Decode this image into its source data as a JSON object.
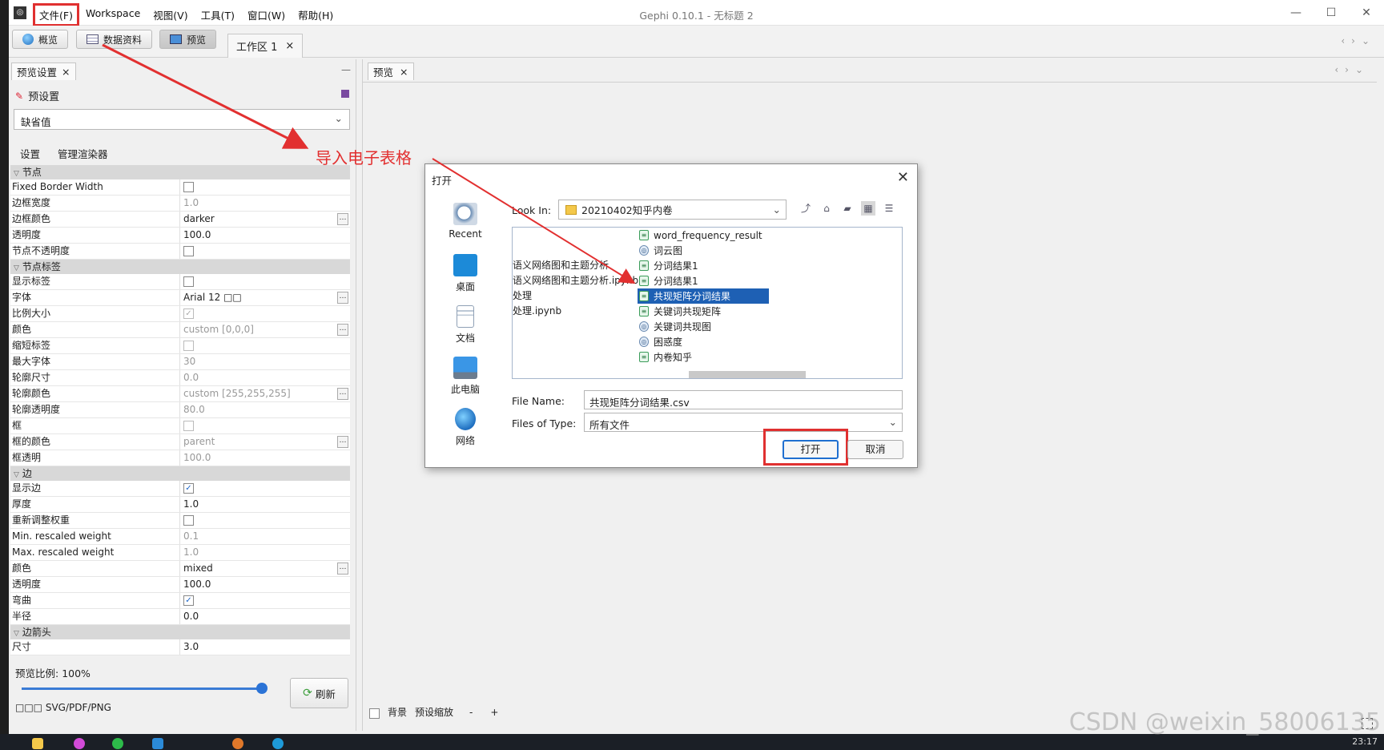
{
  "window": {
    "title": "Gephi 0.10.1 - 无标题 2",
    "controls": [
      "—",
      "☐",
      "✕"
    ]
  },
  "menu": [
    "文件(F)",
    "Workspace",
    "视图(V)",
    "工具(T)",
    "窗口(W)",
    "帮助(H)"
  ],
  "toolbar": {
    "modes": [
      "概览",
      "数据资料",
      "预览"
    ],
    "workspace_tab": "工作区 1"
  },
  "left_panel": {
    "tab": "预览设置",
    "preset_title": "预设置",
    "preset_value": "缺省值",
    "sub_tabs": [
      "设置",
      "管理渲染器"
    ],
    "categories": [
      {
        "name": "节点",
        "rows": [
          {
            "name": "Fixed Border Width",
            "value": "",
            "type": "check",
            "checked": false
          },
          {
            "name": "边框宽度",
            "value": "1.0",
            "dim": true
          },
          {
            "name": "边框颜色",
            "value": "darker",
            "ellipsis": true
          },
          {
            "name": "透明度",
            "value": "100.0"
          },
          {
            "name": "节点不透明度",
            "value": "",
            "type": "check",
            "checked": false
          }
        ]
      },
      {
        "name": "节点标签",
        "rows": [
          {
            "name": "显示标签",
            "value": "",
            "type": "check",
            "checked": false
          },
          {
            "name": "字体",
            "value": "Arial 12 □□",
            "ellipsis": true
          },
          {
            "name": "比例大小",
            "value": "",
            "type": "check",
            "checked": true,
            "dim": true
          },
          {
            "name": "颜色",
            "value": "custom [0,0,0]",
            "dim": true,
            "ellipsis": true
          },
          {
            "name": "缩短标签",
            "value": "",
            "type": "check",
            "checked": false,
            "dim": true
          },
          {
            "name": "最大字体",
            "value": "30",
            "dim": true
          },
          {
            "name": "轮廓尺寸",
            "value": "0.0",
            "dim": true
          },
          {
            "name": "轮廓颜色",
            "value": "custom [255,255,255]",
            "dim": true,
            "ellipsis": true
          },
          {
            "name": "轮廓透明度",
            "value": "80.0",
            "dim": true
          },
          {
            "name": "框",
            "value": "",
            "type": "check",
            "checked": false,
            "dim": true
          },
          {
            "name": "框的颜色",
            "value": "parent",
            "dim": true,
            "ellipsis": true
          },
          {
            "name": "框透明",
            "value": "100.0",
            "dim": true
          }
        ]
      },
      {
        "name": "边",
        "rows": [
          {
            "name": "显示边",
            "value": "",
            "type": "check",
            "checked": true
          },
          {
            "name": "厚度",
            "value": "1.0"
          },
          {
            "name": "重新调整权重",
            "value": "",
            "type": "check",
            "checked": false
          },
          {
            "name": "Min. rescaled weight",
            "value": "0.1",
            "dim": true
          },
          {
            "name": "Max. rescaled weight",
            "value": "1.0",
            "dim": true
          },
          {
            "name": "颜色",
            "value": "mixed",
            "ellipsis": true
          },
          {
            "name": "透明度",
            "value": "100.0"
          },
          {
            "name": "弯曲",
            "value": "",
            "type": "check",
            "checked": true
          },
          {
            "name": "半径",
            "value": "0.0"
          }
        ]
      },
      {
        "name": "边箭头",
        "rows": [
          {
            "name": "尺寸",
            "value": "3.0"
          }
        ]
      }
    ],
    "scale_label": "预览比例:",
    "scale_value": "100%",
    "scale_fraction": 1.0,
    "refresh_label": "刷新",
    "export_label": "□□□  SVG/PDF/PNG"
  },
  "preview_panel": {
    "tab": "预览",
    "background_label": "背景",
    "zoom_label": "预设缩放",
    "minus": "-",
    "plus": "+"
  },
  "annotation": {
    "text": "导入电子表格",
    "color": "#e23030"
  },
  "dialog": {
    "title": "打开",
    "places": [
      "Recent",
      "桌面",
      "文档",
      "此电脑",
      "网络"
    ],
    "look_in_label": "Look In:",
    "look_in_value": "20210402知乎内卷",
    "left_column_items": [
      "语义网络图和主题分析",
      "语义网络图和主题分析.ipynb",
      "处理",
      "处理.ipynb"
    ],
    "files": [
      {
        "name": "word_frequency_result",
        "icon": "spreadsheet-icon"
      },
      {
        "name": "词云图",
        "icon": "image-icon"
      },
      {
        "name": "分词结果1",
        "icon": "spreadsheet-icon"
      },
      {
        "name": "分词结果1",
        "icon": "spreadsheet-icon"
      },
      {
        "name": "共现矩阵分词结果",
        "icon": "spreadsheet-icon",
        "selected": true
      },
      {
        "name": "关键词共现矩阵",
        "icon": "spreadsheet-icon"
      },
      {
        "name": "关键词共现图",
        "icon": "image-icon"
      },
      {
        "name": "困惑度",
        "icon": "image-icon"
      },
      {
        "name": "内卷知乎",
        "icon": "spreadsheet-icon"
      }
    ],
    "file_name_label": "File Name:",
    "file_name_value": "共现矩阵分词结果.csv",
    "file_type_label": "Files of Type:",
    "file_type_value": "所有文件",
    "open_label": "打开",
    "cancel_label": "取消"
  },
  "taskbar": {
    "clock": "23:17"
  },
  "watermark": "CSDN @weixin_58006135"
}
